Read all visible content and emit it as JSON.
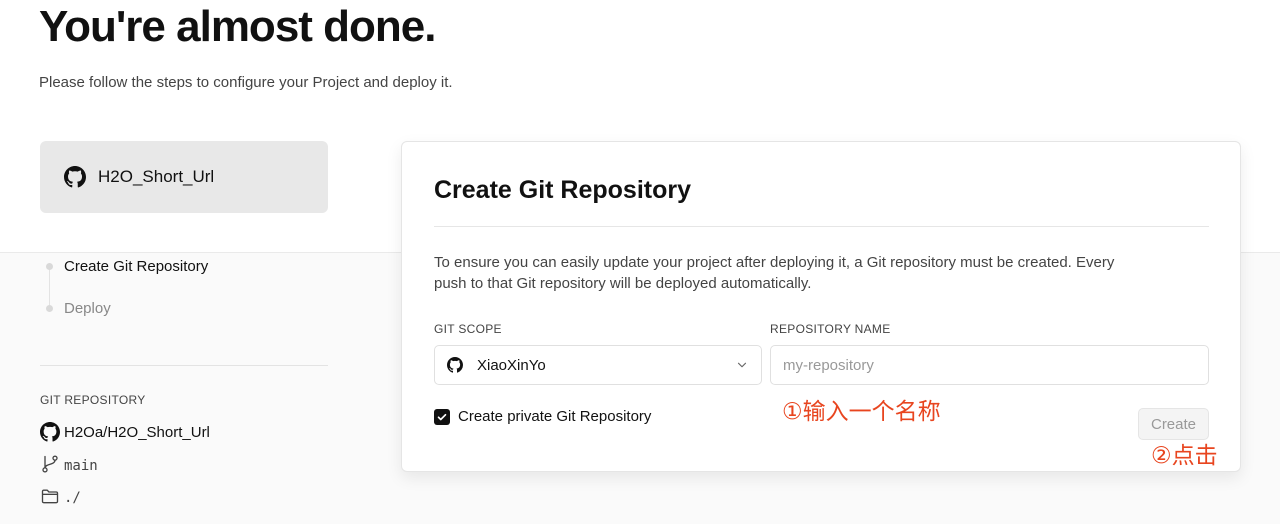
{
  "header": {
    "title": "You're almost done.",
    "subtitle": "Please follow the steps to configure your Project and deploy it."
  },
  "project": {
    "name": "H2O_Short_Url",
    "icon": "github-icon"
  },
  "steps": [
    {
      "label": "Create Git Repository",
      "active": true
    },
    {
      "label": "Deploy",
      "active": false
    }
  ],
  "git_repository": {
    "section_title": "GIT REPOSITORY",
    "repo": "H2Oa/H2O_Short_Url",
    "branch": "main",
    "directory": "./"
  },
  "panel": {
    "title": "Create Git Repository",
    "description": "To ensure you can easily update your project after deploying it, a Git repository must be created. Every push to that Git repository will be deployed automatically.",
    "scope_label": "GIT SCOPE",
    "scope_value": "XiaoXinYo",
    "repo_label": "REPOSITORY NAME",
    "repo_placeholder": "my-repository",
    "repo_value": "",
    "private_label": "Create private Git Repository",
    "private_checked": true,
    "create_button": "Create"
  },
  "annotations": {
    "step1": "①输入一个名称",
    "step2": "②点击"
  },
  "colors": {
    "annotation": "#e8451f",
    "accent": "#111111"
  }
}
